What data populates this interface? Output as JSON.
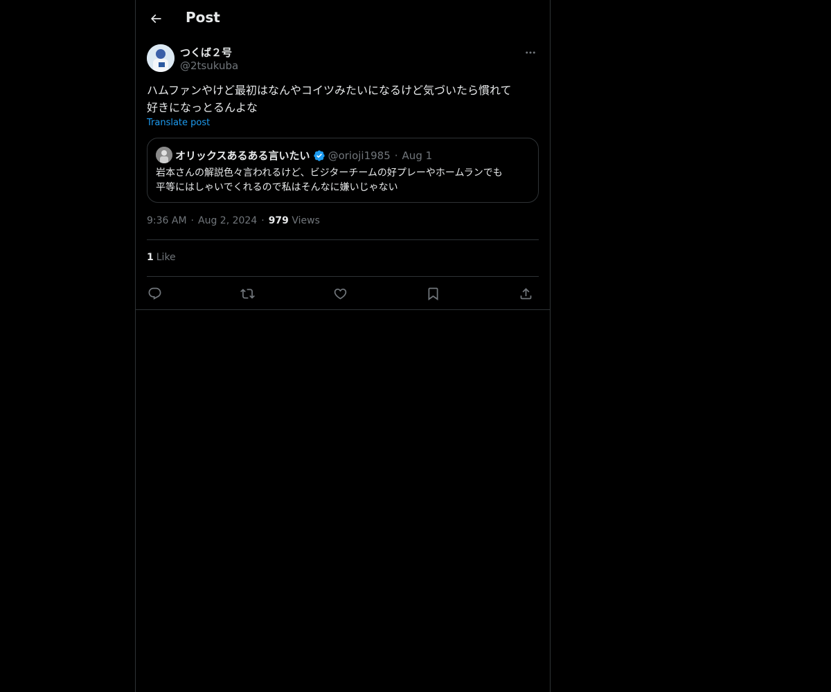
{
  "header": {
    "title": "Post",
    "back_icon": "arrow-left-icon"
  },
  "post": {
    "author_name": "つくば２号",
    "author_handle": "@2tsukuba",
    "text_line1": "ハムファンやけど最初はなんやコイツみたいになるけど気づいたら慣れて",
    "text_line2": "好きになっとるんよな",
    "translate_label": "Translate post",
    "time": "9:36 AM",
    "date": "Aug 2, 2024",
    "views_count": "979",
    "views_label": "Views",
    "likes_count": "1",
    "likes_label": "Like"
  },
  "quote": {
    "author_name": "オリックスあるある言いたい",
    "verified": true,
    "author_handle": "@orioji1985",
    "date": "Aug 1",
    "text_line1": "岩本さんの解説色々言われるけど、ビジターチームの好プレーやホームランでも",
    "text_line2": "平等にはしゃいでくれるので私はそんなに嫌いじゃない"
  },
  "actions": [
    {
      "name": "reply-button",
      "icon": "reply-icon"
    },
    {
      "name": "repost-button",
      "icon": "repost-icon"
    },
    {
      "name": "like-button",
      "icon": "heart-icon"
    },
    {
      "name": "bookmark-button",
      "icon": "bookmark-icon"
    },
    {
      "name": "share-button",
      "icon": "share-icon"
    }
  ],
  "colors": {
    "background": "#000000",
    "text": "#e7e9ea",
    "secondary_text": "#71767b",
    "accent": "#1d9bf0",
    "border": "#2f3336"
  }
}
